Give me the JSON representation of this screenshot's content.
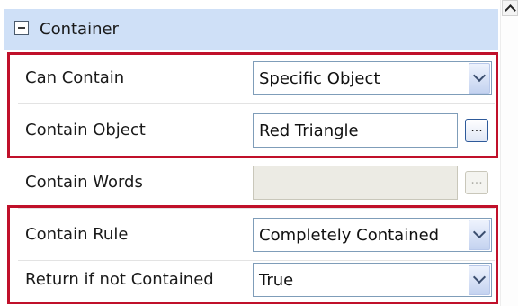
{
  "header": {
    "title": "Container"
  },
  "rows": [
    {
      "label": "Can Contain",
      "value": "Specific Object"
    },
    {
      "label": "Contain Object",
      "value": "Red Triangle",
      "ellipsis": "..."
    },
    {
      "label": "Contain Words",
      "value": "",
      "ellipsis": "..."
    },
    {
      "label": "Contain Rule",
      "value": "Completely Contained"
    },
    {
      "label": "Return if not Contained",
      "value": "True"
    }
  ],
  "colors": {
    "header_bg": "#cfe0f7",
    "highlight": "#c0102a"
  },
  "icons": {
    "collapse": "minus-box-icon",
    "dropdown": "chevron-down-icon",
    "scroll": "chevron-up-icon"
  }
}
